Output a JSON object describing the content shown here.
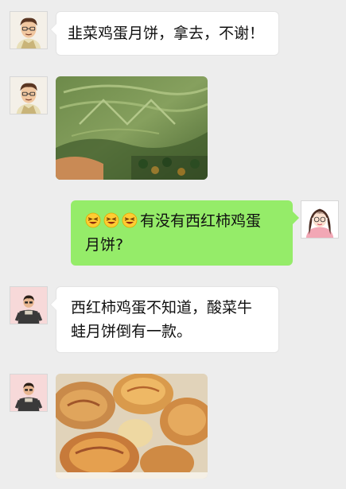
{
  "messages": [
    {
      "sender": "friend",
      "type": "text",
      "text": "韭菜鸡蛋月饼，拿去，不谢！"
    },
    {
      "sender": "friend",
      "type": "image",
      "image": "green-mooncake-photo"
    },
    {
      "sender": "me",
      "type": "text",
      "emoji": [
        "squint-laugh-emoji",
        "squint-laugh-emoji",
        "squint-laugh-emoji"
      ],
      "line1": "有没有西红柿鸡蛋",
      "line2": "月饼?"
    },
    {
      "sender": "other",
      "type": "text",
      "line1": "西红柿鸡蛋不知道，酸菜牛",
      "line2": "蛙月饼倒有一款。"
    },
    {
      "sender": "other",
      "type": "image",
      "image": "pastry-mooncakes-photo"
    }
  ],
  "colors": {
    "background": "#ededed",
    "outgoing_bubble": "#95ec69",
    "incoming_bubble": "#ffffff"
  }
}
